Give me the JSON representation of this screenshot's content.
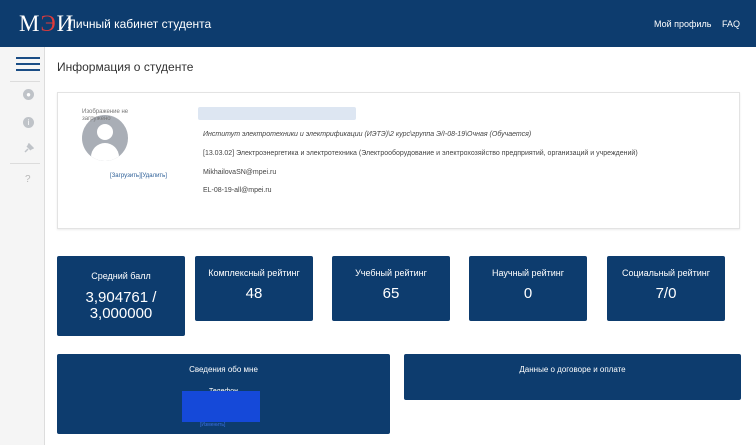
{
  "header": {
    "logo_left": "М",
    "logo_accent": "Э",
    "logo_right": "И",
    "app_title": "Личный кабинет студента",
    "nav": {
      "profile": "Мой профиль",
      "faq": "FAQ"
    }
  },
  "sidebar": {
    "icons": [
      "menu-icon",
      "bell-icon",
      "info-icon",
      "pin-icon",
      "help-icon"
    ],
    "help_glyph": "?"
  },
  "page": {
    "title": "Информация о студенте"
  },
  "student": {
    "photo_alt": "Изображение не загружено",
    "photo_upload": "[Загрузить]",
    "photo_delete": "[Удалить]",
    "institute_line": "Институт электротехники и электрификации (ИЭТЭ)\\2 курс\\группа Э/I-08-19\\Очная (Обучается)",
    "program_line": "[13.03.02] Электроэнергетика и электротехника (Электрооборудование и электрохозяйство предприятий, организаций и учреждений)",
    "email": "MikhailovaSN@mpei.ru",
    "group_email": "EL-08-19-all@mpei.ru"
  },
  "stats": [
    {
      "label": "Средний балл",
      "value": "3,904761 / 3,000000"
    },
    {
      "label": "Комплексный рейтинг",
      "value": "48"
    },
    {
      "label": "Учебный рейтинг",
      "value": "65"
    },
    {
      "label": "Научный рейтинг",
      "value": "0"
    },
    {
      "label": "Социальный рейтинг",
      "value": "7/0"
    }
  ],
  "sections": {
    "about": {
      "title": "Сведения обо мне",
      "phone_label": "Телефон",
      "edit": "[Изменить]"
    },
    "contract": {
      "title": "Данные о договоре и оплате"
    }
  },
  "colors": {
    "primary": "#0d3c6e",
    "accent": "#e03a3a",
    "link": "#2a5d96"
  }
}
